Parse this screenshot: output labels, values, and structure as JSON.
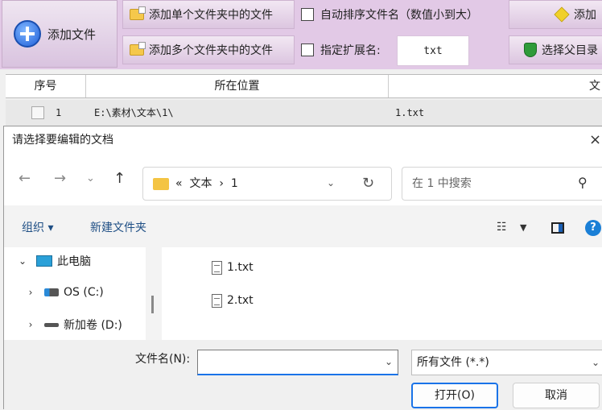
{
  "app": {
    "add_file_label": "添加文件",
    "add_single_folder": "添加单个文件夹中的文件",
    "add_multi_folder": "添加多个文件夹中的文件",
    "auto_sort": "自动排序文件名（数值小到大）",
    "specify_ext": "指定扩展名:",
    "ext_value": "txt",
    "add_partial": "添加",
    "select_parent": "选择父目录",
    "table": {
      "headers": [
        "序号",
        "所在位置",
        "文"
      ],
      "rows": [
        {
          "index": "1",
          "location": "E:\\素材\\文本\\1\\",
          "name": "1.txt"
        }
      ]
    }
  },
  "dialog": {
    "title": "请选择要编辑的文档",
    "close": "×",
    "breadcrumb": [
      "«",
      "文本",
      "›",
      "1"
    ],
    "search_placeholder": "在 1 中搜索",
    "organize": "组织 ▾",
    "new_folder": "新建文件夹",
    "tree": [
      {
        "label": "此电脑",
        "chevron": "⌄"
      },
      {
        "label": "OS (C:)",
        "chevron": "›"
      },
      {
        "label": "新加卷 (D:)",
        "chevron": "›"
      }
    ],
    "files": [
      "1.txt",
      "2.txt"
    ],
    "filename_label": "文件名(N):",
    "filename_value": "",
    "filetype_value": "所有文件 (*.*)",
    "open_label": "打开(O)",
    "cancel_label": "取消",
    "help": "?"
  }
}
